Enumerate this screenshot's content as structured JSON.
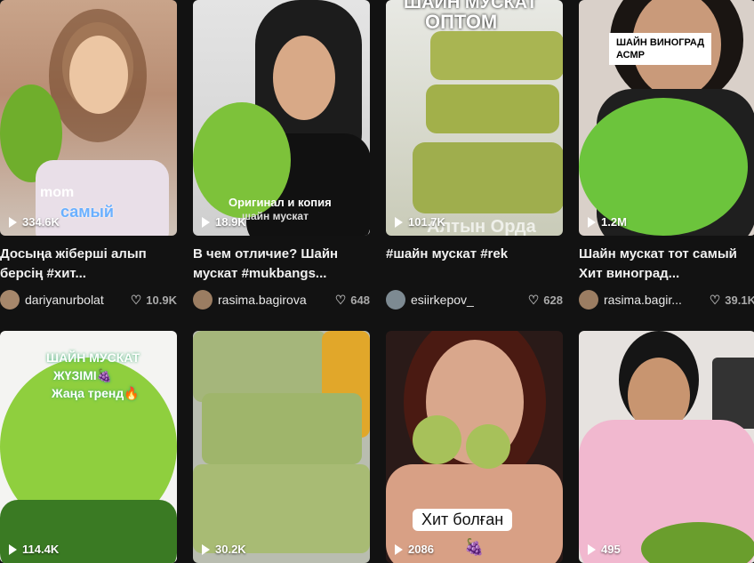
{
  "videos": [
    {
      "views": "334.6K",
      "title": "Досыңа жіберші алып берсің #хит...",
      "author": "dariyanurbolat",
      "likes": "10.9K",
      "overlay": [
        "mom",
        "самый"
      ]
    },
    {
      "views": "18.9K",
      "title": "В чем отличие? Шайн мускат #mukbangs...",
      "author": "rasima.bagirova",
      "likes": "648",
      "overlay": [
        "Оригинал и копия",
        "шайн мускат"
      ]
    },
    {
      "views": "101.7K",
      "title": "#шайн мускат #rek",
      "author": "esiirkepov_",
      "likes": "628",
      "overlay": [
        "ШАЙН МУСКАТ",
        "ОПТОМ",
        "Алтын Орда"
      ]
    },
    {
      "views": "1.2M",
      "title": "Шайн мускат тот самый Хит виноград...",
      "author": "rasima.bagir...",
      "likes": "39.1K",
      "overlay": [
        "ШАЙН ВИНОГРАД",
        "АСМР"
      ]
    },
    {
      "views": "114.4K",
      "overlay": [
        "ШАЙН МУСКАТ",
        "ЖҮЗІМІ🍇",
        "Жаңа тренд🔥"
      ]
    },
    {
      "views": "30.2K",
      "overlay": []
    },
    {
      "views": "2086",
      "overlay": [
        "Хит болған",
        "🍇"
      ]
    },
    {
      "views": "495",
      "overlay": []
    }
  ],
  "colors": {
    "background": "#121212",
    "grape": "#8ec63f",
    "grape_dark": "#5d9a2a"
  }
}
